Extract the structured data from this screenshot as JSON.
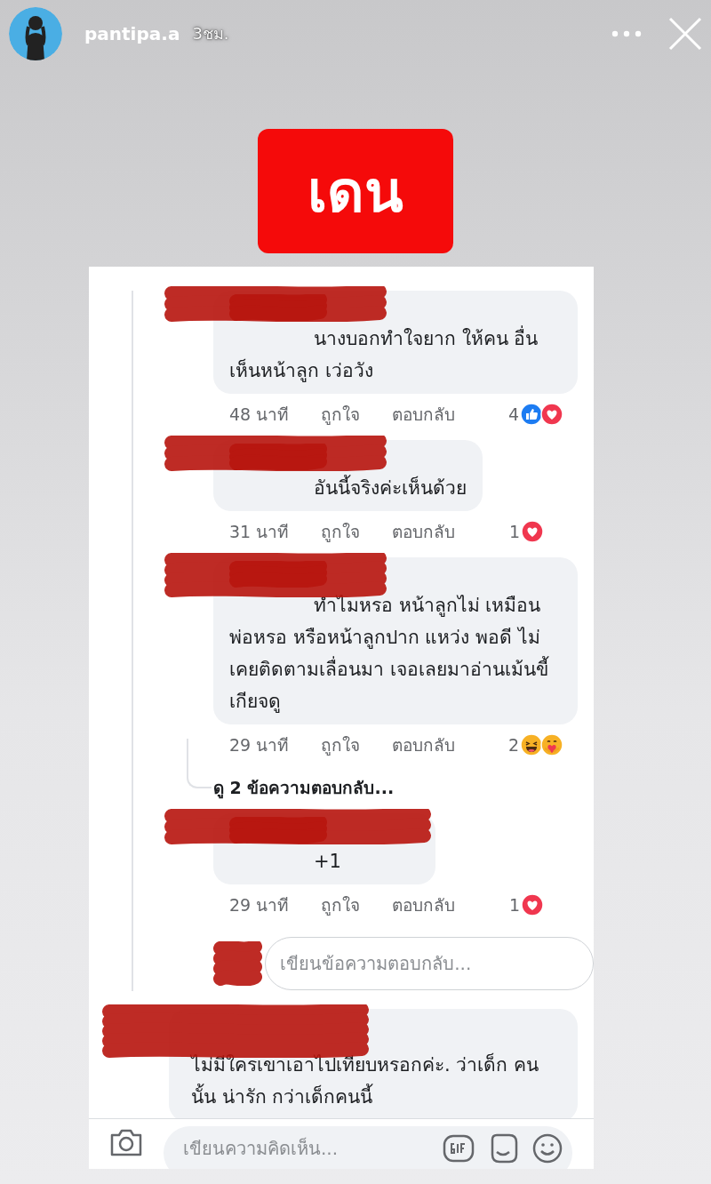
{
  "story": {
    "username": "pantipa.a",
    "time": "3ชม."
  },
  "label": "เดน",
  "comments": [
    {
      "text": "นางบอกทำใจยาก ให้คน อื่นเห็นหน้าลูก เว่อวัง",
      "time": "48 นาที",
      "like": "ถูกใจ",
      "reply": "ตอบกลับ",
      "reaction_count": "4",
      "reactions": [
        {
          "kind": "like"
        },
        {
          "kind": "love"
        }
      ]
    },
    {
      "text": "อันนี้จริงค่ะเห็นด้วย",
      "time": "31 นาที",
      "like": "ถูกใจ",
      "reply": "ตอบกลับ",
      "reaction_count": "1",
      "reactions": [
        {
          "kind": "love"
        }
      ]
    },
    {
      "text": "ทำไมหรอ หน้าลูกไม่ เหมือนพ่อหรอ หรือหน้าลูกปาก แหว่ง พอดี ไม่เคยติดตามเลื่อนมา เจอเลยมาอ่านเม้นขี้เกียจดู",
      "time": "29 นาที",
      "like": "ถูกใจ",
      "reply": "ตอบกลับ",
      "reaction_count": "2",
      "reactions": [
        {
          "kind": "haha"
        },
        {
          "kind": "care"
        }
      ],
      "view_replies": "ดู 2 ข้อความตอบกลับ..."
    },
    {
      "text": "+1",
      "time": "29 นาที",
      "like": "ถูกใจ",
      "reply": "ตอบกลับ",
      "reaction_count": "1",
      "reactions": [
        {
          "kind": "love"
        }
      ]
    }
  ],
  "reply_field": {
    "placeholder": "เขียนข้อความตอบกลับ..."
  },
  "top_comment": {
    "text": "ไม่มีใครเขาเอาไปเทียบหรอกค่ะ. ว่าเด็ก คนนั้น น่ารัก กว่าเด็กคนนี้"
  },
  "comment_bar": {
    "placeholder": "เขียนความคิดเห็น..."
  }
}
